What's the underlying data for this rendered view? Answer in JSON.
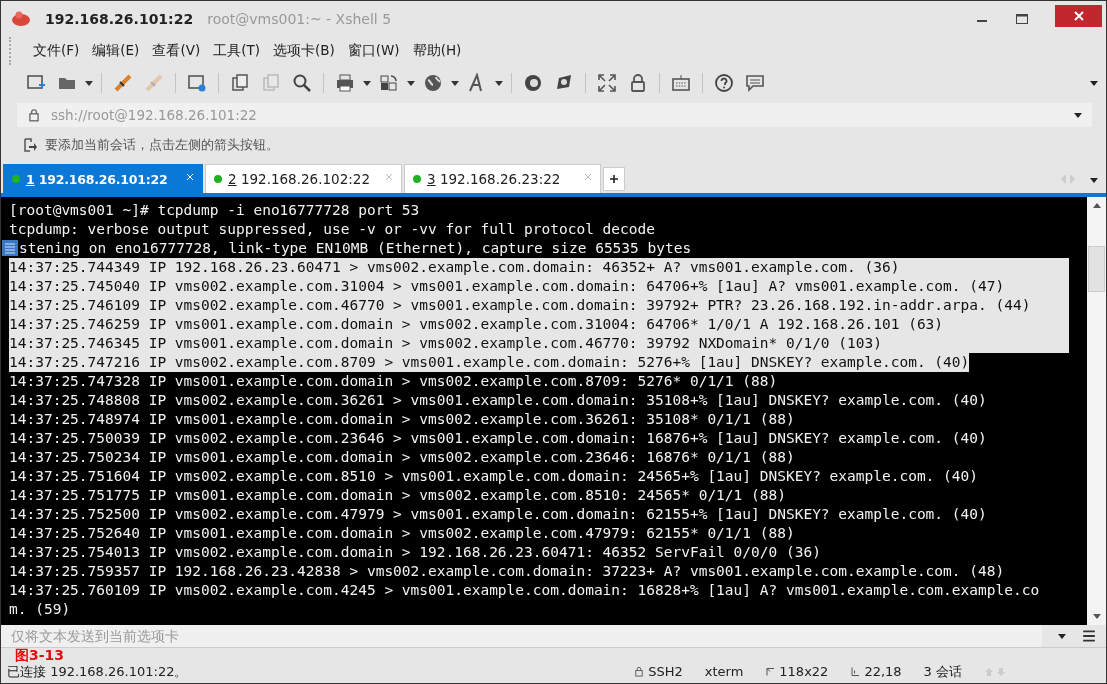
{
  "window": {
    "title": "192.168.26.101:22",
    "subtitle": "root@vms001:~ - Xshell 5"
  },
  "menu": [
    "文件(F)",
    "编辑(E)",
    "查看(V)",
    "工具(T)",
    "选项卡(B)",
    "窗口(W)",
    "帮助(H)"
  ],
  "address_bar": {
    "value": "ssh://root@192.168.26.101:22"
  },
  "hint_bar": {
    "text": "要添加当前会话，点击左侧的箭头按钮。"
  },
  "tabs": [
    {
      "number": "1",
      "label": "192.168.26.101:22",
      "selected": true
    },
    {
      "number": "2",
      "label": "192.168.26.102:22",
      "selected": false
    },
    {
      "number": "3",
      "label": "192.168.26.23:22",
      "selected": false
    }
  ],
  "terminal": {
    "lines": [
      {
        "text": "[root@vms001 ~]# tcpdump -i eno16777728 port 53",
        "selected": false
      },
      {
        "text": "tcpdump: verbose output suppressed, use -v or -vv for full protocol decode",
        "selected": false
      },
      {
        "text": "stening on eno16777728, link-type EN10MB (Ethernet), capture size 65535 bytes",
        "selected": false,
        "gutter_icon": true
      },
      {
        "text": "14:37:25.744349 IP 192.168.26.23.60471 > vms002.example.com.domain: 46352+ A? vms001.example.com. (36)",
        "selected": true
      },
      {
        "text": "14:37:25.745040 IP vms002.example.com.31004 > vms001.example.com.domain: 64706+% [1au] A? vms001.example.com. (47)",
        "selected": true
      },
      {
        "text": "14:37:25.746109 IP vms002.example.com.46770 > vms001.example.com.domain: 39792+ PTR? 23.26.168.192.in-addr.arpa. (44)",
        "selected": true
      },
      {
        "text": "14:37:25.746259 IP vms001.example.com.domain > vms002.example.com.31004: 64706* 1/0/1 A 192.168.26.101 (63)",
        "selected": true
      },
      {
        "text": "14:37:25.746345 IP vms001.example.com.domain > vms002.example.com.46770: 39792 NXDomain* 0/1/0 (103)",
        "selected": true
      },
      {
        "text": "14:37:25.747216 IP vms002.example.com.8709 > vms001.example.com.domain: 5276+% [1au] DNSKEY? example.com. (40)",
        "selected": true
      },
      {
        "text": "14:37:25.747328 IP vms001.example.com.domain > vms002.example.com.8709: 5276* 0/1/1 (88)",
        "selected": false
      },
      {
        "text": "14:37:25.748808 IP vms002.example.com.36261 > vms001.example.com.domain: 35108+% [1au] DNSKEY? example.com. (40)",
        "selected": false
      },
      {
        "text": "14:37:25.748974 IP vms001.example.com.domain > vms002.example.com.36261: 35108* 0/1/1 (88)",
        "selected": false
      },
      {
        "text": "14:37:25.750039 IP vms002.example.com.23646 > vms001.example.com.domain: 16876+% [1au] DNSKEY? example.com. (40)",
        "selected": false
      },
      {
        "text": "14:37:25.750234 IP vms001.example.com.domain > vms002.example.com.23646: 16876* 0/1/1 (88)",
        "selected": false
      },
      {
        "text": "14:37:25.751604 IP vms002.example.com.8510 > vms001.example.com.domain: 24565+% [1au] DNSKEY? example.com. (40)",
        "selected": false
      },
      {
        "text": "14:37:25.751775 IP vms001.example.com.domain > vms002.example.com.8510: 24565* 0/1/1 (88)",
        "selected": false
      },
      {
        "text": "14:37:25.752500 IP vms002.example.com.47979 > vms001.example.com.domain: 62155+% [1au] DNSKEY? example.com. (40)",
        "selected": false
      },
      {
        "text": "14:37:25.752640 IP vms001.example.com.domain > vms002.example.com.47979: 62155* 0/1/1 (88)",
        "selected": false
      },
      {
        "text": "14:37:25.754013 IP vms002.example.com.domain > 192.168.26.23.60471: 46352 ServFail 0/0/0 (36)",
        "selected": false
      },
      {
        "text": "14:37:25.759357 IP 192.168.26.23.42838 > vms002.example.com.domain: 37223+ A? vms001.example.com.example.com. (48)",
        "selected": false
      },
      {
        "text": "14:37:25.760109 IP vms002.example.com.4245 > vms001.example.com.domain: 16828+% [1au] A? vms001.example.com.example.co",
        "selected": false
      },
      {
        "text": "m. (59)",
        "selected": false
      }
    ]
  },
  "compose_bar": {
    "placeholder": "仅将文本发送到当前选项卡"
  },
  "figure_label": "图3-13",
  "status_bar": {
    "connection": "已连接 192.168.26.101:22。",
    "protocol": "SSH2",
    "terminal_type": "xterm",
    "size": "118x22",
    "cursor": "22,18",
    "sessions": "3 会话"
  }
}
